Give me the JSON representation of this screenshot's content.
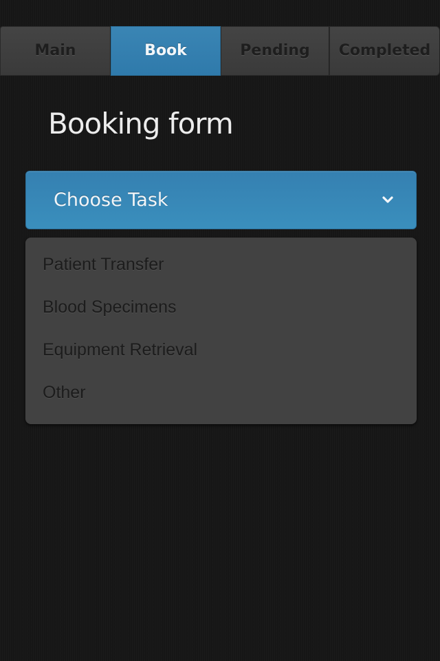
{
  "tabs": [
    {
      "label": "Main",
      "active": false
    },
    {
      "label": "Book",
      "active": true
    },
    {
      "label": "Pending",
      "active": false
    },
    {
      "label": "Completed",
      "active": false
    }
  ],
  "page": {
    "title": "Booking form"
  },
  "task_select": {
    "label": "Choose Task",
    "icon": "chevron-down-icon",
    "options": [
      "Patient Transfer",
      "Blood Specimens",
      "Equipment Retrieval",
      "Other"
    ]
  },
  "colors": {
    "accent": "#3585b5",
    "background": "#161616",
    "tab_inactive": "#3f3f3f",
    "menu_bg": "#424242"
  }
}
